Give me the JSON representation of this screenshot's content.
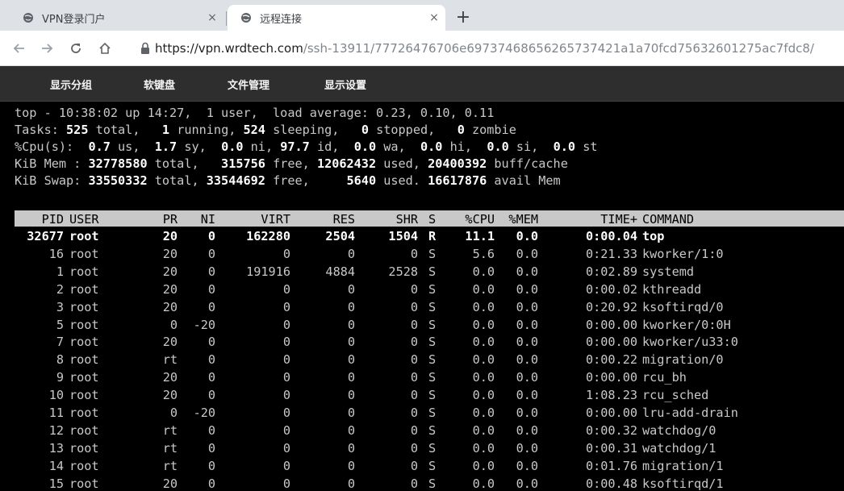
{
  "browser": {
    "tabs": [
      {
        "title": "VPN登录门户",
        "close": "×"
      },
      {
        "title": "远程连接",
        "close": "×"
      }
    ],
    "new_tab": "+",
    "url_host": "https://vpn.wrdtech.com",
    "url_path": "/ssh-13911/77726476706e69737468656265737421a1a70fcd75632601275ac7fdc8/"
  },
  "menu": {
    "items": [
      "显示分组",
      "软键盘",
      "文件管理",
      "显示设置"
    ]
  },
  "terminal": {
    "summary": {
      "uptime_line": "top - 10:38:02 up 14:27,  1 user,  load average: 0.23, 0.10, 0.11",
      "tasks": {
        "label": "Tasks:",
        "total": "525",
        "running": "1",
        "sleeping": "524",
        "stopped": "0",
        "zombie": "0"
      },
      "cpu": {
        "label": "%Cpu(s):",
        "us": "0.7",
        "sy": "1.7",
        "ni": "0.0",
        "id": "97.7",
        "wa": "0.0",
        "hi": "0.0",
        "si": "0.0",
        "st": "0.0"
      },
      "mem": {
        "label": "KiB Mem :",
        "total": "32778580",
        "free": "315756",
        "used": "12062432",
        "buff_cache": "20400392"
      },
      "swap": {
        "label": "KiB Swap:",
        "total": "33550332",
        "free": "33544692",
        "used": "5640",
        "avail": "16617876"
      }
    },
    "columns": [
      "PID",
      "USER",
      "PR",
      "NI",
      "VIRT",
      "RES",
      "SHR",
      "S",
      "%CPU",
      "%MEM",
      "TIME+",
      "COMMAND"
    ],
    "processes": [
      {
        "pid": "32677",
        "user": "root",
        "pr": "20",
        "ni": "0",
        "virt": "162280",
        "res": "2504",
        "shr": "1504",
        "s": "R",
        "cpu": "11.1",
        "mem": "0.0",
        "time": "0:00.04",
        "command": "top"
      },
      {
        "pid": "16",
        "user": "root",
        "pr": "20",
        "ni": "0",
        "virt": "0",
        "res": "0",
        "shr": "0",
        "s": "S",
        "cpu": "5.6",
        "mem": "0.0",
        "time": "0:21.33",
        "command": "kworker/1:0"
      },
      {
        "pid": "1",
        "user": "root",
        "pr": "20",
        "ni": "0",
        "virt": "191916",
        "res": "4884",
        "shr": "2528",
        "s": "S",
        "cpu": "0.0",
        "mem": "0.0",
        "time": "0:02.89",
        "command": "systemd"
      },
      {
        "pid": "2",
        "user": "root",
        "pr": "20",
        "ni": "0",
        "virt": "0",
        "res": "0",
        "shr": "0",
        "s": "S",
        "cpu": "0.0",
        "mem": "0.0",
        "time": "0:00.02",
        "command": "kthreadd"
      },
      {
        "pid": "3",
        "user": "root",
        "pr": "20",
        "ni": "0",
        "virt": "0",
        "res": "0",
        "shr": "0",
        "s": "S",
        "cpu": "0.0",
        "mem": "0.0",
        "time": "0:20.92",
        "command": "ksoftirqd/0"
      },
      {
        "pid": "5",
        "user": "root",
        "pr": "0",
        "ni": "-20",
        "virt": "0",
        "res": "0",
        "shr": "0",
        "s": "S",
        "cpu": "0.0",
        "mem": "0.0",
        "time": "0:00.00",
        "command": "kworker/0:0H"
      },
      {
        "pid": "7",
        "user": "root",
        "pr": "20",
        "ni": "0",
        "virt": "0",
        "res": "0",
        "shr": "0",
        "s": "S",
        "cpu": "0.0",
        "mem": "0.0",
        "time": "0:00.00",
        "command": "kworker/u33:0"
      },
      {
        "pid": "8",
        "user": "root",
        "pr": "rt",
        "ni": "0",
        "virt": "0",
        "res": "0",
        "shr": "0",
        "s": "S",
        "cpu": "0.0",
        "mem": "0.0",
        "time": "0:00.22",
        "command": "migration/0"
      },
      {
        "pid": "9",
        "user": "root",
        "pr": "20",
        "ni": "0",
        "virt": "0",
        "res": "0",
        "shr": "0",
        "s": "S",
        "cpu": "0.0",
        "mem": "0.0",
        "time": "0:00.00",
        "command": "rcu_bh"
      },
      {
        "pid": "10",
        "user": "root",
        "pr": "20",
        "ni": "0",
        "virt": "0",
        "res": "0",
        "shr": "0",
        "s": "S",
        "cpu": "0.0",
        "mem": "0.0",
        "time": "1:08.23",
        "command": "rcu_sched"
      },
      {
        "pid": "11",
        "user": "root",
        "pr": "0",
        "ni": "-20",
        "virt": "0",
        "res": "0",
        "shr": "0",
        "s": "S",
        "cpu": "0.0",
        "mem": "0.0",
        "time": "0:00.00",
        "command": "lru-add-drain"
      },
      {
        "pid": "12",
        "user": "root",
        "pr": "rt",
        "ni": "0",
        "virt": "0",
        "res": "0",
        "shr": "0",
        "s": "S",
        "cpu": "0.0",
        "mem": "0.0",
        "time": "0:00.32",
        "command": "watchdog/0"
      },
      {
        "pid": "13",
        "user": "root",
        "pr": "rt",
        "ni": "0",
        "virt": "0",
        "res": "0",
        "shr": "0",
        "s": "S",
        "cpu": "0.0",
        "mem": "0.0",
        "time": "0:00.31",
        "command": "watchdog/1"
      },
      {
        "pid": "14",
        "user": "root",
        "pr": "rt",
        "ni": "0",
        "virt": "0",
        "res": "0",
        "shr": "0",
        "s": "S",
        "cpu": "0.0",
        "mem": "0.0",
        "time": "0:01.76",
        "command": "migration/1"
      },
      {
        "pid": "15",
        "user": "root",
        "pr": "20",
        "ni": "0",
        "virt": "0",
        "res": "0",
        "shr": "0",
        "s": "S",
        "cpu": "0.0",
        "mem": "0.0",
        "time": "0:00.48",
        "command": "ksoftirqd/1"
      }
    ]
  },
  "colors": {
    "tab_bar": "#dee1e6",
    "menu_bar": "#2e2e2e",
    "terminal_bg": "#000000",
    "terminal_fg": "#c8c8c8",
    "header_bar": "#c8c8c8"
  }
}
